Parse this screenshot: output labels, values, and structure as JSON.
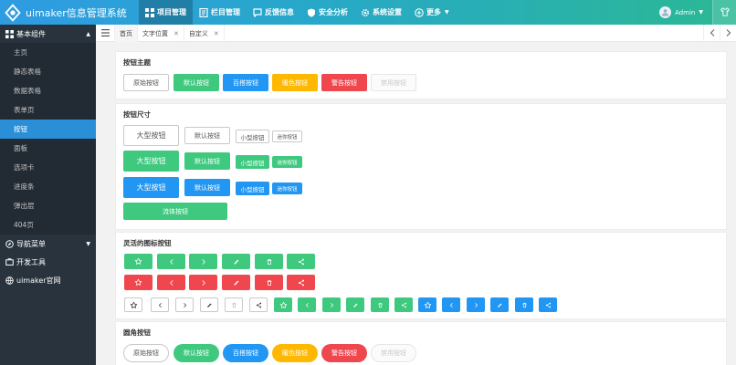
{
  "app": {
    "title": "uimaker信息管理系统"
  },
  "topnav": [
    {
      "label": "项目管理",
      "icon": "grid-icon",
      "active": true
    },
    {
      "label": "栏目管理",
      "icon": "document-icon",
      "active": false
    },
    {
      "label": "反馈信息",
      "icon": "chat-icon",
      "active": false
    },
    {
      "label": "安全分析",
      "icon": "shield-icon",
      "active": false
    },
    {
      "label": "系统设置",
      "icon": "gear-icon",
      "active": false
    },
    {
      "label": "更多",
      "icon": "plus-circle-icon",
      "active": false
    }
  ],
  "user": {
    "name": "Admin"
  },
  "sidebar": {
    "group_basic": "基本组件",
    "items": [
      "主页",
      "静态表格",
      "数据表格",
      "表单页",
      "按钮",
      "面板",
      "选项卡",
      "进度条",
      "弹出层",
      "404页"
    ],
    "active_item": "按钮",
    "group_nav": "导航菜单",
    "group_dev": "开发工具",
    "group_site": "uimaker官网"
  },
  "tabs": [
    {
      "label": "首页",
      "closable": false
    },
    {
      "label": "文字位置",
      "closable": true
    },
    {
      "label": "自定义",
      "closable": true
    }
  ],
  "sections": {
    "theme": {
      "title": "按钮主题",
      "buttons": [
        "原始按钮",
        "默认按钮",
        "百搭按钮",
        "暖色按钮",
        "警告按钮",
        "禁用按钮"
      ]
    },
    "size": {
      "title": "按钮尺寸",
      "large": "大型按钮",
      "default": "默认按钮",
      "small": "小型按钮",
      "mini": "迷你按钮",
      "fluid": "流体按钮"
    },
    "icon": {
      "title": "灵活的图标按钮",
      "icons": [
        "star-icon",
        "chevron-left-icon",
        "chevron-right-icon",
        "edit-icon",
        "trash-icon",
        "share-icon"
      ]
    },
    "round": {
      "title": "圆角按钮",
      "buttons": [
        "原始按钮",
        "默认按钮",
        "百搭按钮",
        "暖色按钮",
        "警告按钮",
        "禁用按钮"
      ]
    }
  },
  "colors": {
    "primary": "#ffffff",
    "default": "#3ec97f",
    "normal": "#2196f3",
    "warm": "#ffb800",
    "danger": "#f0464e",
    "sidebar": "#28333e",
    "sidebar_active": "#2b8fd8"
  }
}
